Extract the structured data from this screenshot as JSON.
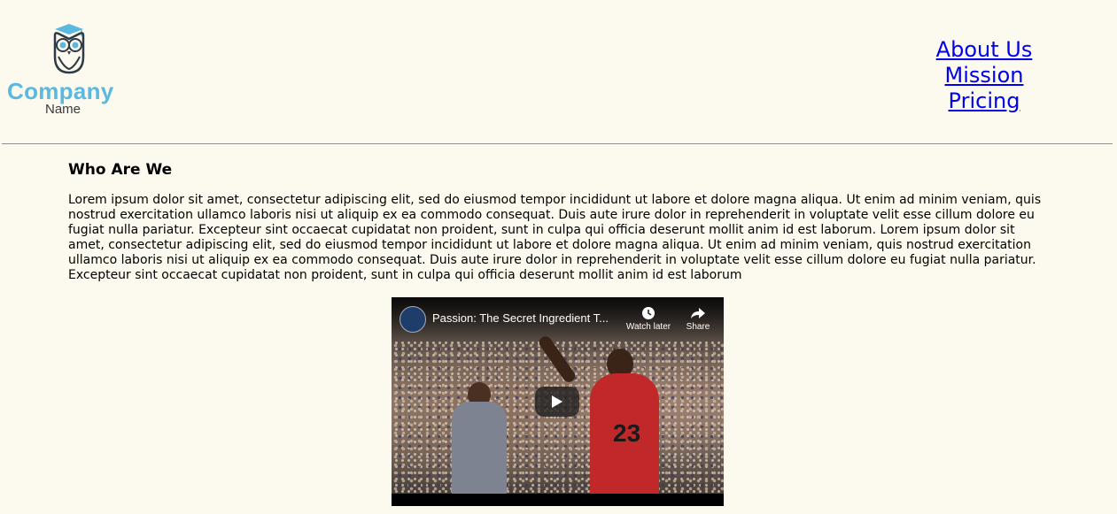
{
  "logo": {
    "company": "Company",
    "name": "Name"
  },
  "nav": {
    "items": [
      {
        "label": "About Us"
      },
      {
        "label": "Mission"
      },
      {
        "label": "Pricing"
      }
    ]
  },
  "main": {
    "heading": "Who Are We",
    "paragraph": "Lorem ipsum dolor sit amet, consectetur adipiscing elit, sed do eiusmod tempor incididunt ut labore et dolore magna aliqua. Ut enim ad minim veniam, quis nostrud exercitation ullamco laboris nisi ut aliquip ex ea commodo consequat. Duis aute irure dolor in reprehenderit in voluptate velit esse cillum dolore eu fugiat nulla pariatur. Excepteur sint occaecat cupidatat non proident, sunt in culpa qui officia deserunt mollit anim id est laborum. Lorem ipsum dolor sit amet, consectetur adipiscing elit, sed do eiusmod tempor incididunt ut labore et dolore magna aliqua. Ut enim ad minim veniam, quis nostrud exercitation ullamco laboris nisi ut aliquip ex ea commodo consequat. Duis aute irure dolor in reprehenderit in voluptate velit esse cillum dolore eu fugiat nulla pariatur. Excepteur sint occaecat cupidatat non proident, sunt in culpa qui officia deserunt mollit anim id est laborum"
  },
  "video": {
    "title": "Passion: The Secret Ingredient T...",
    "watch_later": "Watch later",
    "share": "Share",
    "jersey_number": "23"
  },
  "colors": {
    "background": "#fcf9ee",
    "link": "#0000ee",
    "logo_accent": "#5bb9e0"
  },
  "icons": [
    "owl-logo-icon",
    "clock-icon",
    "share-icon",
    "play-icon"
  ]
}
